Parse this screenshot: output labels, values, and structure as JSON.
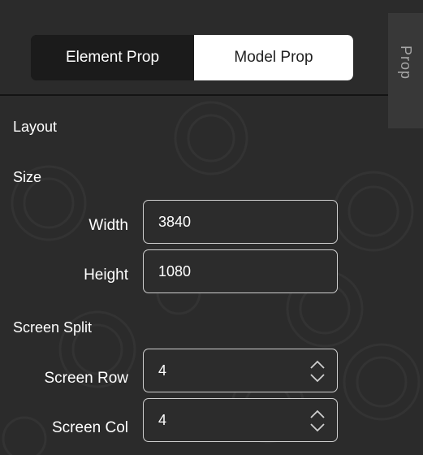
{
  "tabs": {
    "element_prop": "Element Prop",
    "model_prop": "Model Prop"
  },
  "side_tab": {
    "label": "Prop"
  },
  "sections": {
    "layout": "Layout",
    "size": "Size",
    "screen_split": "Screen Split"
  },
  "size": {
    "width_label": "Width",
    "width_value": "3840",
    "height_label": "Height",
    "height_value": "1080"
  },
  "screen_split": {
    "row_label": "Screen Row",
    "row_value": "4",
    "col_label": "Screen Col",
    "col_value": "4"
  },
  "colors": {
    "background": "#2b2b2b",
    "tab_active": "#ffffff",
    "tab_inactive": "#1b1b1b",
    "field_border": "#cfcfcf"
  }
}
